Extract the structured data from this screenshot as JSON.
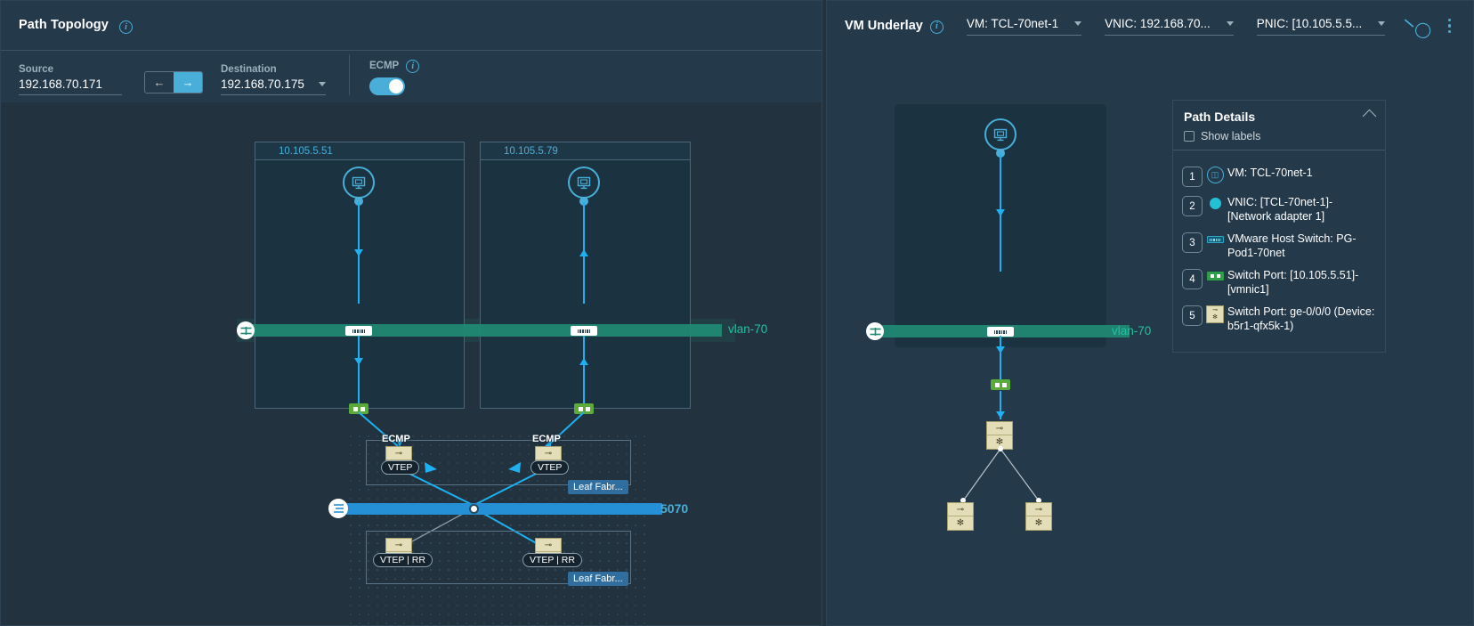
{
  "left": {
    "title": "Path Topology",
    "info_icon": "info-icon",
    "source": {
      "label": "Source",
      "value": "192.168.70.171"
    },
    "destination": {
      "label": "Destination",
      "value": "192.168.70.175"
    },
    "direction": {
      "back_icon": "arrow-left-icon",
      "forward_icon": "arrow-right-icon",
      "selected": "forward"
    },
    "ecmp": {
      "label": "ECMP",
      "enabled": true
    },
    "topology": {
      "hosts": [
        {
          "id": "10.105.5.51"
        },
        {
          "id": "10.105.5.79"
        }
      ],
      "vlan_label": "vlan-70",
      "overlay_label": "5070",
      "fabric_tag_top": "Leaf Fabr...",
      "ecmp_tags": [
        "ECMP",
        "ECMP"
      ],
      "leaf_tags": [
        "VTEP",
        "VTEP"
      ],
      "spine_tags": [
        "VTEP | RR",
        "VTEP | RR"
      ]
    }
  },
  "right": {
    "title": "VM Underlay",
    "selectors": [
      {
        "name": "vm-selector",
        "label": "VM: TCL-70net-1"
      },
      {
        "name": "vnic-selector",
        "label": "VNIC: 192.168.70..."
      },
      {
        "name": "pnic-selector",
        "label": "PNIC: [10.105.5.5..."
      }
    ],
    "pin_icon": "pin-icon",
    "more_icon": "kebab-menu-icon",
    "topology": {
      "vlan_label": "vlan-70"
    },
    "path_details": {
      "title": "Path Details",
      "show_labels": {
        "label": "Show labels",
        "checked": false
      },
      "items": [
        {
          "num": "1",
          "icon": "vm-icon",
          "text": "VM: TCL-70net-1"
        },
        {
          "num": "2",
          "icon": "vnic-dot-icon",
          "text": "VNIC: [TCL-70net-1]-[Network adapter 1]"
        },
        {
          "num": "3",
          "icon": "host-switch-icon",
          "text": "VMware Host Switch: PG-Pod1-70net"
        },
        {
          "num": "4",
          "icon": "switch-port-icon",
          "text": "Switch Port: [10.105.5.51]-[vmnic1]"
        },
        {
          "num": "5",
          "icon": "device-node-icon",
          "text": "Switch Port: ge-0/0/0 (Device: b5r1-qfx5k-1)"
        }
      ]
    }
  },
  "colors": {
    "accent_blue": "#49afd9",
    "link_blue": "#1eb0f0",
    "vlan_green": "#22c1a0",
    "panel_bg": "#24394a",
    "canvas_bg": "#22333f",
    "node_tan": "#e3ddb8"
  }
}
